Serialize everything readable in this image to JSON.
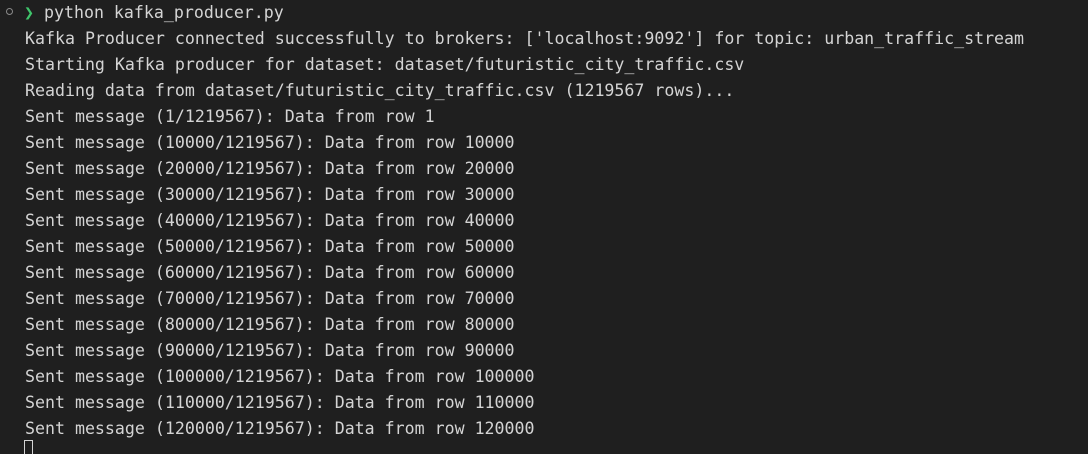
{
  "prompt": {
    "symbol": "❯",
    "command": "python kafka_producer.py"
  },
  "output": [
    "Kafka Producer connected successfully to brokers: ['localhost:9092'] for topic: urban_traffic_stream",
    "Starting Kafka producer for dataset: dataset/futuristic_city_traffic.csv",
    "Reading data from dataset/futuristic_city_traffic.csv (1219567 rows)...",
    "Sent message (1/1219567): Data from row 1",
    "Sent message (10000/1219567): Data from row 10000",
    "Sent message (20000/1219567): Data from row 20000",
    "Sent message (30000/1219567): Data from row 30000",
    "Sent message (40000/1219567): Data from row 40000",
    "Sent message (50000/1219567): Data from row 50000",
    "Sent message (60000/1219567): Data from row 60000",
    "Sent message (70000/1219567): Data from row 70000",
    "Sent message (80000/1219567): Data from row 80000",
    "Sent message (90000/1219567): Data from row 90000",
    "Sent message (100000/1219567): Data from row 100000",
    "Sent message (110000/1219567): Data from row 110000",
    "Sent message (120000/1219567): Data from row 120000"
  ],
  "colors": {
    "background": "#1f1f1f",
    "text": "#d4d4d4",
    "prompt_symbol": "#3fc56b"
  }
}
